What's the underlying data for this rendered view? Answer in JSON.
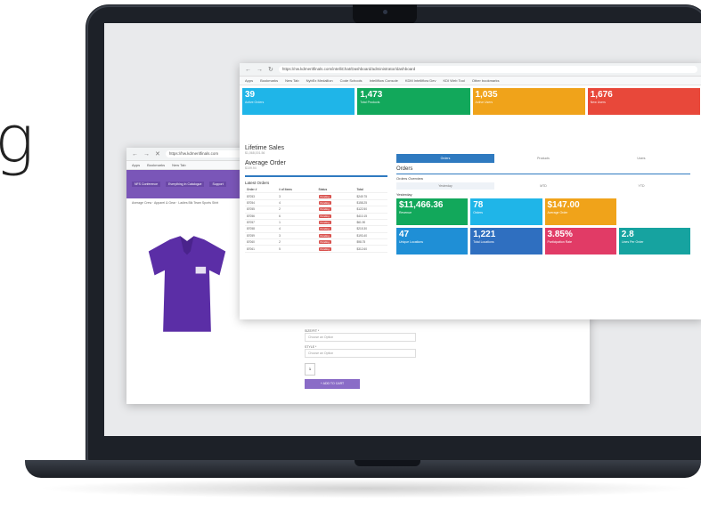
{
  "edge_text": "g",
  "back_window": {
    "url": "https://hw.kdmeritfinals.com",
    "bookmarks": [
      "Apps",
      "Bookmarks",
      "New Tab"
    ],
    "nav": [
      "NFS Conference",
      "Everything In Catalogue",
      "Support"
    ],
    "crumbs": "Average Crew · Apparel & Gear · Ladies Blk Team Sports Shirt",
    "form_labels": [
      "SIZE/FIT *",
      "STYLE *"
    ],
    "select_placeholder": "Choose an Option",
    "qty": "1",
    "cart_button": "+ ADD TO CART"
  },
  "front_window": {
    "url": "https://nw.kdmeritfinals.com/intelliChat/Dashboard/administrator/dashboard",
    "bookmarks": [
      "Apps",
      "Bookmarks",
      "New Tab",
      "NybEx Medallion",
      "Code Schools",
      "Intelliflow Console",
      "KDM Intelliflow Dev",
      "KDI Web Tool",
      "Other bookmarks"
    ],
    "top_tiles": [
      {
        "value": "39",
        "label": "Active Orders",
        "color": "#1fb5e8"
      },
      {
        "value": "1,473",
        "label": "Total Products",
        "color": "#12a85b"
      },
      {
        "value": "1,035",
        "label": "Active Users",
        "color": "#f0a31a"
      },
      {
        "value": "1,676",
        "label": "New Users",
        "color": "#e8483a"
      }
    ],
    "lifetime_sales": {
      "title": "Lifetime Sales",
      "value": "$1,068,001.56"
    },
    "average_order": {
      "title": "Average Order",
      "value": "$109.94"
    },
    "latest_orders": {
      "title": "Latest Orders",
      "columns": [
        "Order #",
        "# of Items",
        "Status",
        "Total"
      ],
      "rows": [
        [
          "87053",
          "3",
          "Pending",
          "$249.75"
        ],
        [
          "87054",
          "4",
          "Pending",
          "$158.25"
        ],
        [
          "87055",
          "2",
          "Pending",
          "$122.50"
        ],
        [
          "87056",
          "6",
          "Pending",
          "$410.15"
        ],
        [
          "87057",
          "1",
          "Pending",
          "$61.90"
        ],
        [
          "87058",
          "4",
          "Pending",
          "$215.30"
        ],
        [
          "87059",
          "3",
          "Pending",
          "$193.40"
        ],
        [
          "87060",
          "2",
          "Pending",
          "$98.75"
        ],
        [
          "87061",
          "5",
          "Pending",
          "$312.60"
        ]
      ]
    },
    "tabs": [
      "Orders",
      "Products",
      "Users"
    ],
    "orders_title": "Orders",
    "orders_overview": "Orders Overview",
    "subtabs": [
      "Yesterday",
      "MTD",
      "YTD"
    ],
    "period": "Yesterday",
    "grid_tiles": [
      {
        "value": "$11,466.36",
        "label": "Revenue",
        "color": "#12a85b"
      },
      {
        "value": "78",
        "label": "Orders",
        "color": "#1fb5e8"
      },
      {
        "value": "$147.00",
        "label": "Average Order",
        "color": "#f0a31a"
      },
      {
        "value": "",
        "label": "",
        "color": "#ffffff"
      },
      {
        "value": "47",
        "label": "Unique Locations",
        "color": "#1f8fd6"
      },
      {
        "value": "1,221",
        "label": "Total Locations",
        "color": "#2f6fc0"
      },
      {
        "value": "3.85%",
        "label": "Participation Rate",
        "color": "#e13b66"
      },
      {
        "value": "2.8",
        "label": "Lines Per Order",
        "color": "#16a3a0"
      }
    ]
  }
}
